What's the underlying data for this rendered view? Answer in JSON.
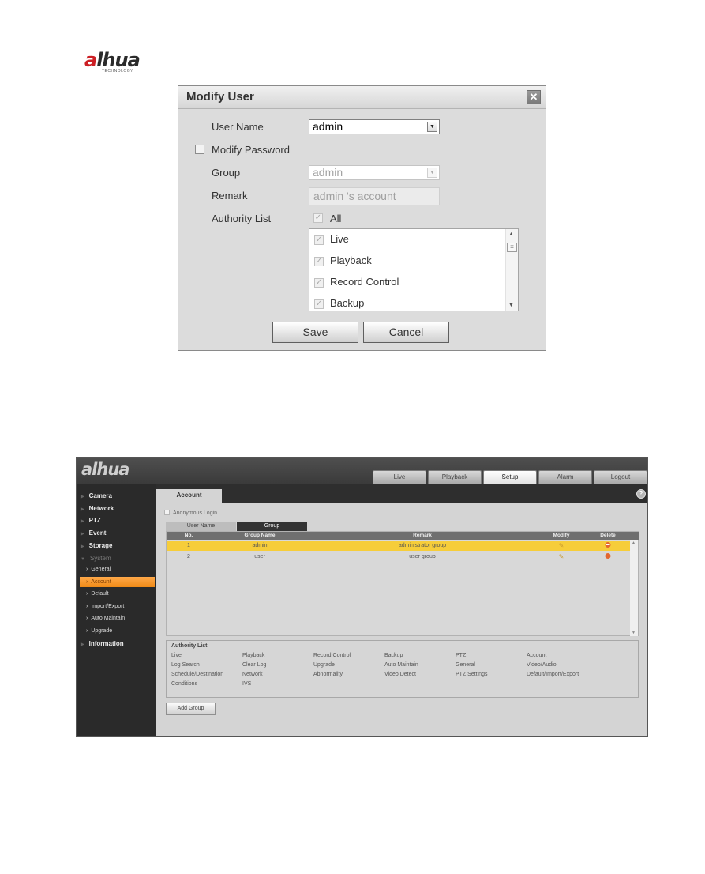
{
  "logo": {
    "brand_prefix": "a",
    "brand_rest": "lhua",
    "tagline": "TECHNOLOGY"
  },
  "dialog": {
    "title": "Modify User",
    "close_icon": "close-icon",
    "user_name_label": "User Name",
    "user_name_value": "admin",
    "modify_password_label": "Modify Password",
    "modify_password_checked": false,
    "group_label": "Group",
    "group_value": "admin",
    "remark_label": "Remark",
    "remark_value": "admin 's account",
    "authority_label": "Authority List",
    "all_label": "All",
    "all_checked": true,
    "authority_items": [
      {
        "label": "Live",
        "checked": true
      },
      {
        "label": "Playback",
        "checked": true
      },
      {
        "label": "Record Control",
        "checked": true
      },
      {
        "label": "Backup",
        "checked": true
      }
    ],
    "save_label": "Save",
    "cancel_label": "Cancel"
  },
  "web": {
    "logo": "alhua",
    "nav_tabs": [
      {
        "label": "Live",
        "active": false
      },
      {
        "label": "Playback",
        "active": false
      },
      {
        "label": "Setup",
        "active": true
      },
      {
        "label": "Alarm",
        "active": false
      },
      {
        "label": "Logout",
        "active": false
      }
    ],
    "sidebar": {
      "items": [
        {
          "label": "Camera"
        },
        {
          "label": "Network"
        },
        {
          "label": "PTZ"
        },
        {
          "label": "Event"
        },
        {
          "label": "Storage"
        },
        {
          "label": "System"
        },
        {
          "label": "Information"
        }
      ],
      "system_sub": [
        {
          "label": "General",
          "active": false
        },
        {
          "label": "Account",
          "active": true
        },
        {
          "label": "Default",
          "active": false
        },
        {
          "label": "Import/Export",
          "active": false
        },
        {
          "label": "Auto Maintain",
          "active": false
        },
        {
          "label": "Upgrade",
          "active": false
        }
      ]
    },
    "main": {
      "tab": "Account",
      "help_icon": "?",
      "anonymous_login_label": "Anonymous Login",
      "sub_tabs": {
        "user_name": "User Name",
        "group": "Group"
      },
      "table": {
        "columns": [
          "No.",
          "Group Name",
          "Remark",
          "Modify",
          "Delete"
        ],
        "rows": [
          {
            "no": "1",
            "group_name": "admin",
            "remark": "administrator group",
            "selected": true
          },
          {
            "no": "2",
            "group_name": "user",
            "remark": "user group",
            "selected": false
          }
        ]
      },
      "authority_panel": {
        "title": "Authority List",
        "columns": [
          [
            "Live",
            "Log Search",
            "Schedule/Destination",
            "Conditions"
          ],
          [
            "Playback",
            "Clear Log",
            "Network",
            "IVS"
          ],
          [
            "Record Control",
            "Upgrade",
            "Abnormality"
          ],
          [
            "Backup",
            "Auto Maintain",
            "Video Detect"
          ],
          [
            "PTZ",
            "General",
            "PTZ Settings"
          ],
          [
            "Account",
            "Video/Audio",
            "Default/Import/Export"
          ]
        ]
      },
      "add_group_label": "Add Group"
    }
  }
}
